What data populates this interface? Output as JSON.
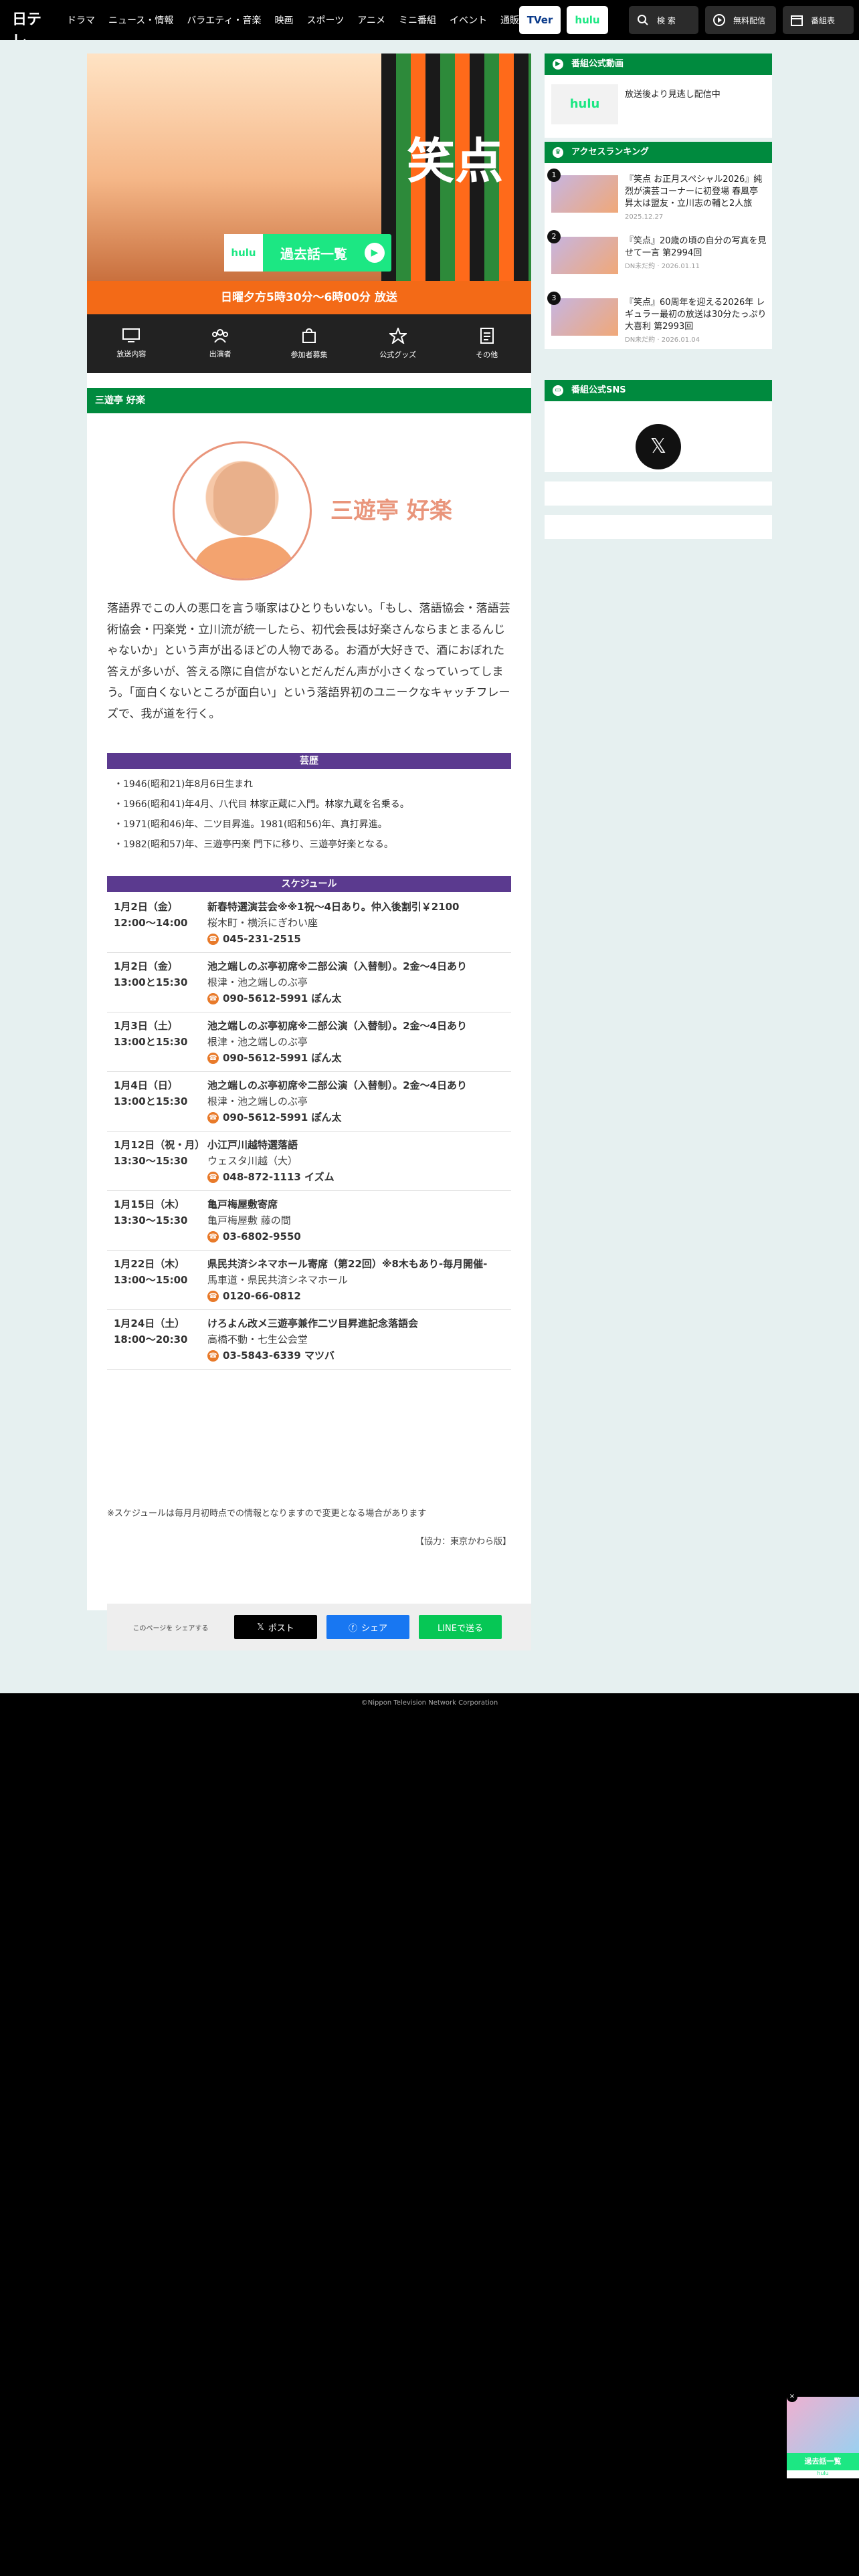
{
  "header": {
    "logo": "日テレ",
    "nav": [
      "ドラマ",
      "ニュース・情報",
      "バラエティ・音楽",
      "映画",
      "スポーツ",
      "アニメ",
      "ミニ番組",
      "イベント",
      "通販"
    ],
    "tver": "TVer",
    "hulu": "hulu",
    "search": "検 索",
    "free": "無料配信",
    "guide": "番組表"
  },
  "hero": {
    "show_title": "笑点",
    "hulu_logo": "hulu",
    "past_episodes": "過去話一覧",
    "airtime": "日曜夕方5時30分～6時00分 放送"
  },
  "subnav": [
    {
      "icon": "tv-icon",
      "label": "放送内容"
    },
    {
      "icon": "people-icon",
      "label": "出演者"
    },
    {
      "icon": "bag-icon",
      "label": "参加者募集"
    },
    {
      "icon": "star-icon",
      "label": "公式グッズ"
    },
    {
      "icon": "document-icon",
      "label": "その他"
    }
  ],
  "section_title": "三遊亭 好楽",
  "performer": {
    "name": "三遊亭 好楽",
    "bio": "落語界でこの人の悪口を言う噺家はひとりもいない。「もし、落語協会・落語芸術協会・円楽党・立川流が統一したら、初代会長は好楽さんならまとまるんじゃないか」という声が出るほどの人物である。お酒が大好きで、酒におぼれた答えが多いが、答える際に自信がないとだんだん声が小さくなっていってしまう。「面白くないところが面白い」という落語界初のユニークなキャッチフレーズで、我が道を行く。"
  },
  "history": {
    "heading": "芸歴",
    "items": [
      "・1946(昭和21)年8月6日生まれ",
      "・1966(昭和41)年4月、八代目 林家正蔵に入門。林家九蔵を名乗る。",
      "・1971(昭和46)年、二ツ目昇進。1981(昭和56)年、真打昇進。",
      "・1982(昭和57)年、三遊亭円楽 門下に移り、三遊亭好楽となる。"
    ]
  },
  "schedule": {
    "heading": "スケジュール",
    "rows": [
      {
        "date": "1月2日（金）",
        "time": "12:00～14:00",
        "event": "新春特選演芸会※※1祝～4日あり。仲入後割引￥2100",
        "venue": "桜木町・横浜にぎわい座",
        "tel": "045-231-2515"
      },
      {
        "date": "1月2日（金）",
        "time": "13:00と15:30",
        "event": "池之端しのぶ亭初席※二部公演（入替制）。2金～4日あり",
        "venue": "根津・池之端しのぶ亭",
        "tel": "090-5612-5991 ぽん太"
      },
      {
        "date": "1月3日（土）",
        "time": "13:00と15:30",
        "event": "池之端しのぶ亭初席※二部公演（入替制）。2金～4日あり",
        "venue": "根津・池之端しのぶ亭",
        "tel": "090-5612-5991 ぽん太"
      },
      {
        "date": "1月4日（日）",
        "time": "13:00と15:30",
        "event": "池之端しのぶ亭初席※二部公演（入替制）。2金～4日あり",
        "venue": "根津・池之端しのぶ亭",
        "tel": "090-5612-5991 ぽん太"
      },
      {
        "date": "1月12日（祝・月）",
        "time": "13:30～15:30",
        "event": "小江戸川越特選落語",
        "venue": "ウェスタ川越（大）",
        "tel": "048-872-1113 イズム"
      },
      {
        "date": "1月15日（木）",
        "time": "13:30～15:30",
        "event": "亀戸梅屋敷寄席",
        "venue": "亀戸梅屋敷 藤の間",
        "tel": "03-6802-9550"
      },
      {
        "date": "1月22日（木）",
        "time": "13:00～15:00",
        "event": "県民共済シネマホール寄席（第22回）※8木もあり-毎月開催-",
        "venue": "馬車道・県民共済シネマホール",
        "tel": "0120-66-0812"
      },
      {
        "date": "1月24日（土）",
        "time": "18:00～20:30",
        "event": "けろよん改メ三遊亭兼作二ツ目昇進記念落語会",
        "venue": "高橋不動・七生公会堂",
        "tel": "03-5843-6339 マツバ"
      }
    ],
    "note": "※スケジュールは毎月月初時点での情報となりますので変更となる場合があります",
    "credit": "【協力：東京かわら版】"
  },
  "share": {
    "label": "このページを シェアする",
    "x": "ポスト",
    "facebook": "シェア",
    "line": "LINEで送る",
    "colors": {
      "x": "#000000",
      "facebook": "#1877f2",
      "line": "#06c755"
    }
  },
  "sidebar": {
    "video_heading": "番組公式動画",
    "video_hulu": "hulu",
    "video_text": "放送後より見逃し配信中",
    "ranking_heading": "アクセスランキング",
    "ranking": [
      {
        "rank": "1",
        "title": "『笑点 お正月スペシャル2026』純烈が演芸コーナーに初登場 春風亭昇太は盟友・立川志の輔と2人旅",
        "date": "2025.12.27"
      },
      {
        "rank": "2",
        "title": "『笑点』20歳の頃の自分の写真を見せて一言 第2994回",
        "date": "DN未だ約 · 2026.01.11"
      },
      {
        "rank": "3",
        "title": "『笑点』60周年を迎える2026年 レギュラー最初の放送は30分たっぷり大喜利 第2993回",
        "date": "DN未だ約 · 2026.01.04"
      }
    ],
    "sns_heading": "番組公式SNS"
  },
  "footer": "©Nippon Television Network Corporation",
  "float_banner": {
    "button": "過去話一覧",
    "logo": "hulu"
  }
}
